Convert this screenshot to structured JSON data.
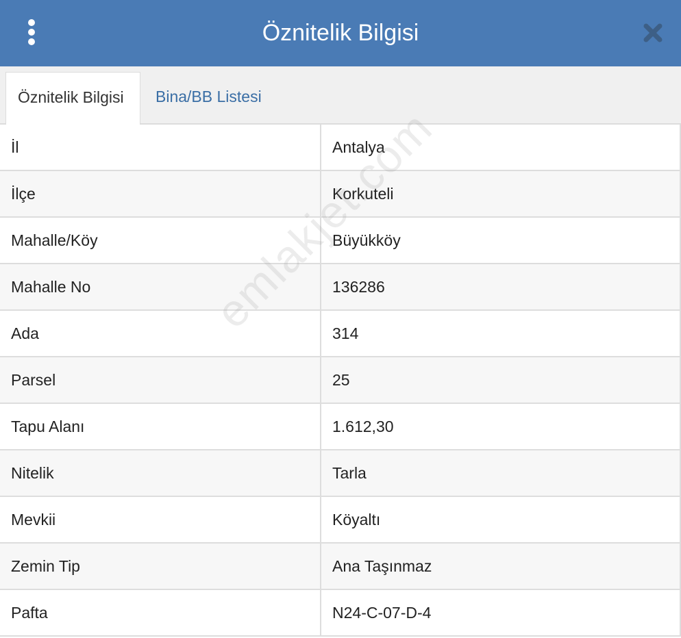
{
  "header": {
    "title": "Öznitelik Bilgisi",
    "menu_icon": "vertical-ellipsis-icon",
    "close_icon": "close-icon",
    "background_color": "#4a7bb5"
  },
  "tabs": [
    {
      "label": "Öznitelik Bilgisi",
      "active": true
    },
    {
      "label": "Bina/BB Listesi",
      "active": false
    }
  ],
  "rows": [
    {
      "key": "İl",
      "value": "Antalya"
    },
    {
      "key": "İlçe",
      "value": "Korkuteli"
    },
    {
      "key": "Mahalle/Köy",
      "value": "Büyükköy"
    },
    {
      "key": "Mahalle No",
      "value": "136286"
    },
    {
      "key": "Ada",
      "value": "314"
    },
    {
      "key": "Parsel",
      "value": "25"
    },
    {
      "key": "Tapu Alanı",
      "value": "1.612,30"
    },
    {
      "key": "Nitelik",
      "value": "Tarla"
    },
    {
      "key": "Mevkii",
      "value": "Köyaltı"
    },
    {
      "key": "Zemin Tip",
      "value": "Ana Taşınmaz"
    },
    {
      "key": "Pafta",
      "value": "N24-C-07-D-4"
    }
  ],
  "watermark": "emlakjet.com"
}
